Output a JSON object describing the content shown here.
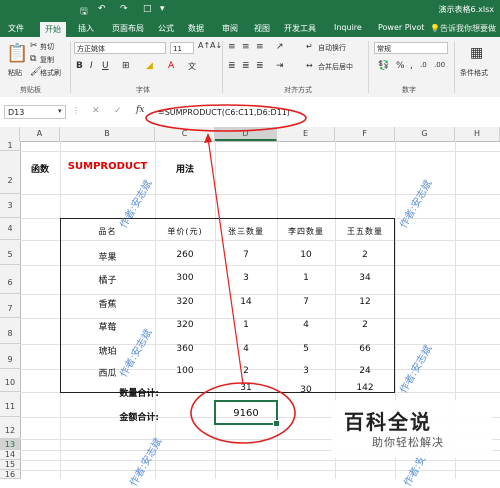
{
  "titlebar": {
    "title": "演示表格6.xlsx"
  },
  "tabs": [
    "文件",
    "开始",
    "插入",
    "页面布局",
    "公式",
    "数据",
    "审阅",
    "视图",
    "开发工具",
    "Inquire",
    "Power Pivot"
  ],
  "tellme": "告诉我你想要做",
  "ribbon": {
    "paste": "粘贴",
    "cut": "剪切",
    "copy": "复制",
    "format_painter": "格式刷",
    "clipboard_label": "剪贴板",
    "font_name": "方正姚体",
    "font_size": "11",
    "font_label": "字体",
    "wrap_text": "自动换行",
    "merge_center": "合并后居中",
    "alignment_label": "对齐方式",
    "number_format": "常规",
    "number_label": "数字",
    "conditional_format": "条件格式"
  },
  "formula_bar": {
    "name_box": "D13",
    "fx": "fx",
    "formula": "=SUMPRODUCT(C6:C11,D6:D11)"
  },
  "columns": [
    "A",
    "B",
    "C",
    "D",
    "E",
    "F",
    "G",
    "H"
  ],
  "rows": [
    "1",
    "2",
    "3",
    "4",
    "5",
    "6",
    "7",
    "8",
    "9",
    "10",
    "11",
    "12",
    "13",
    "14",
    "15",
    "16"
  ],
  "sheet": {
    "row2": {
      "a": "函数",
      "b": "SUMPRODUCT",
      "c": "用法"
    },
    "headers": [
      "品名",
      "单价(元)",
      "张三数量",
      "李四数量",
      "王五数量"
    ],
    "items": [
      {
        "name": "苹果",
        "price": "260",
        "zhang": "7",
        "li": "10",
        "wang": "2"
      },
      {
        "name": "橘子",
        "price": "300",
        "zhang": "3",
        "li": "1",
        "wang": "34"
      },
      {
        "name": "香蕉",
        "price": "320",
        "zhang": "14",
        "li": "7",
        "wang": "12"
      },
      {
        "name": "草莓",
        "price": "320",
        "zhang": "1",
        "li": "4",
        "wang": "2"
      },
      {
        "name": "琥珀",
        "price": "360",
        "zhang": "4",
        "li": "5",
        "wang": "66"
      },
      {
        "name": "西瓜",
        "price": "100",
        "zhang": "2",
        "li": "3",
        "wang": "24"
      }
    ],
    "qty_total_label": "数量合计:",
    "qty_totals": [
      "31",
      "30",
      "142"
    ],
    "amount_total_label": "金额合计:",
    "amount_total": "9160"
  },
  "watermark": "作者:安志斌",
  "logo": {
    "title": "百科全说",
    "subtitle": "助你轻松解决"
  },
  "colors": {
    "excel_green": "#217346",
    "annotation_red": "#e02020",
    "title_red": "#e00000",
    "watermark_blue": "#5b8fd8"
  }
}
